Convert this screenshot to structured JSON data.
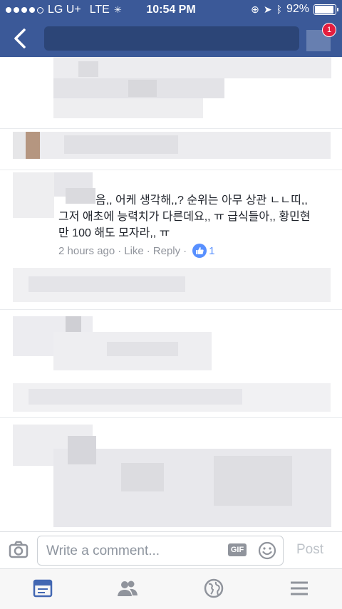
{
  "status": {
    "carrier": "LG U+",
    "network": "LTE",
    "time": "10:54 PM",
    "battery": "92%"
  },
  "nav": {
    "notification_count": "1"
  },
  "comment": {
    "lines": [
      "음,, 어케 생각해,,? 순위는 아무 상관 ㄴㄴ띠,,",
      "그저 애초에 능력치가 다른데요,, ㅠ 급식들아,, 황민현",
      "만 100 해도 모자라,, ㅠ"
    ],
    "time": "2 hours ago",
    "like_label": "Like",
    "reply_label": "Reply",
    "like_count": "1"
  },
  "composer": {
    "placeholder": "Write a comment...",
    "gif_label": "GIF",
    "post_label": "Post"
  },
  "colors": {
    "brand": "#3b5998",
    "like": "#5890ff"
  },
  "icons": [
    "back-arrow-icon",
    "camera-icon",
    "gif-icon",
    "smiley-icon",
    "news-feed-icon",
    "friends-icon",
    "globe-icon",
    "menu-icon"
  ]
}
